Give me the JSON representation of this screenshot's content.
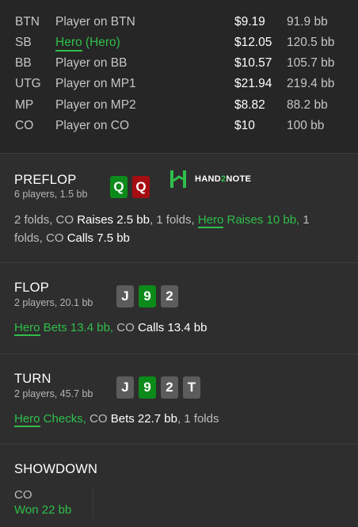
{
  "players": [
    {
      "pos": "BTN",
      "name": "Player on BTN",
      "money": "$9.19",
      "bb": "91.9 bb",
      "hero": false
    },
    {
      "pos": "SB",
      "name_hero": "Hero",
      "name_suffix": " (Hero)",
      "money": "$12.05",
      "bb": "120.5 bb",
      "hero": true
    },
    {
      "pos": "BB",
      "name": "Player on BB",
      "money": "$10.57",
      "bb": "105.7 bb",
      "hero": false
    },
    {
      "pos": "UTG",
      "name": "Player on MP1",
      "money": "$21.94",
      "bb": "219.4 bb",
      "hero": false
    },
    {
      "pos": "MP",
      "name": "Player on MP2",
      "money": "$8.82",
      "bb": "88.2 bb",
      "hero": false
    },
    {
      "pos": "CO",
      "name": "Player on CO",
      "money": "$10",
      "bb": "100 bb",
      "hero": false
    }
  ],
  "preflop": {
    "title": "PREFLOP",
    "sub": "6 players, 1.5 bb",
    "cards": [
      "Q",
      "Q"
    ],
    "logo_text_a": "HAND",
    "logo_text_b": "2",
    "logo_text_c": "NOTE",
    "a1": "2 folds, CO ",
    "a2": "Raises 2.5 bb",
    "a3": ", 1 folds, ",
    "a4": "Hero",
    "a5": " Raises 10 bb,",
    "a6": " 1 folds, CO ",
    "a7": "Calls 7.5 bb"
  },
  "flop": {
    "title": "FLOP",
    "sub": "2 players, 20.1 bb",
    "cards": [
      "J",
      "9",
      "2"
    ],
    "a1": "Hero",
    "a2": " Bets 13.4 bb,",
    "a3": " CO ",
    "a4": "Calls 13.4 bb"
  },
  "turn": {
    "title": "TURN",
    "sub": "2 players, 45.7 bb",
    "cards": [
      "J",
      "9",
      "2",
      "T"
    ],
    "a1": "Hero",
    "a2": " Checks,",
    "a3": " CO ",
    "a4": "Bets 22.7 bb",
    "a5": ", 1 folds"
  },
  "showdown": {
    "title": "SHOWDOWN",
    "player": "CO",
    "result": "Won 22 bb"
  },
  "colors": {
    "accent": "#2fbf4a",
    "card_green": "#0c8a1a",
    "card_red": "#a50d12",
    "card_gray": "#5c5c5c"
  }
}
